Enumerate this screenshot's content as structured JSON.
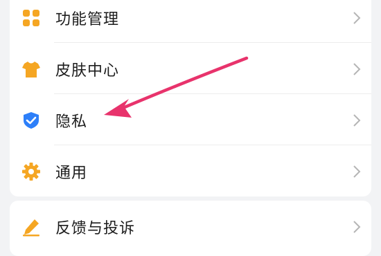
{
  "settings_group_1": {
    "items": [
      {
        "label": "功能管理",
        "icon": "grid-icon",
        "color": "#f5a623"
      },
      {
        "label": "皮肤中心",
        "icon": "shirt-icon",
        "color": "#f5a623"
      },
      {
        "label": "隐私",
        "icon": "shield-check-icon",
        "color": "#2d7ff9"
      },
      {
        "label": "通用",
        "icon": "gear-icon",
        "color": "#f5a623"
      }
    ]
  },
  "settings_group_2": {
    "items": [
      {
        "label": "反馈与投诉",
        "icon": "pencil-icon",
        "color": "#f5a623"
      }
    ]
  },
  "annotation": {
    "color": "#e8336c",
    "icon": "pointer-arrow"
  }
}
